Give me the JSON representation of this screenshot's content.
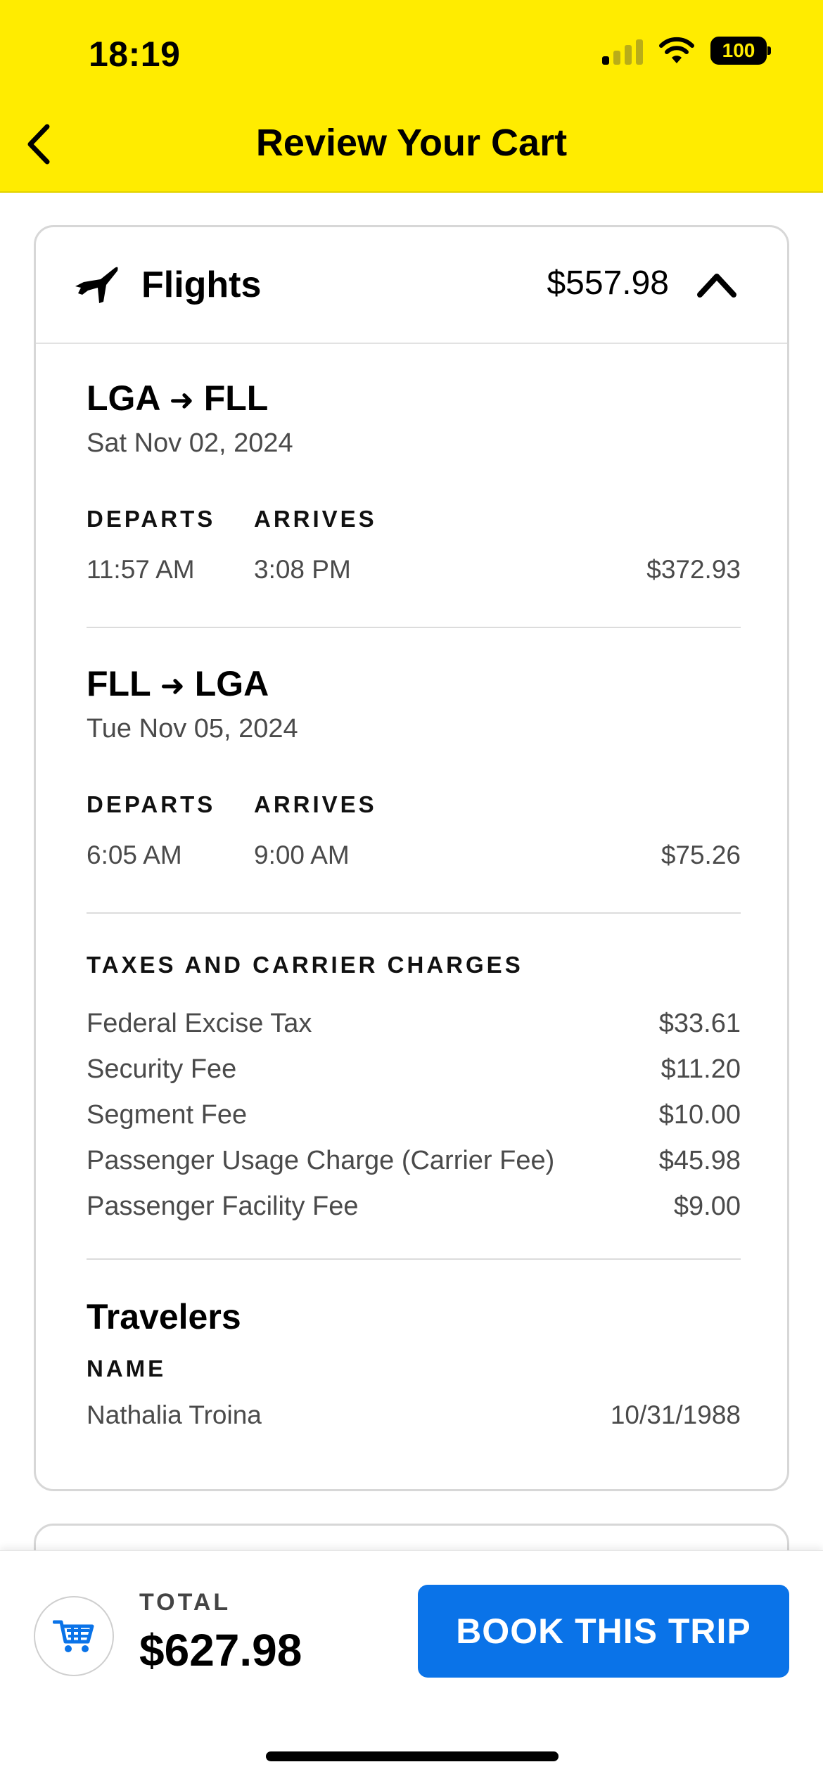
{
  "status_bar": {
    "time": "18:19",
    "battery": "100"
  },
  "header": {
    "title": "Review Your Cart"
  },
  "flights_card": {
    "title": "Flights",
    "price": "$557.98",
    "segments": [
      {
        "route_from": "LGA",
        "route_to": "FLL",
        "date": "Sat Nov 02, 2024",
        "departs_label": "DEPARTS",
        "arrives_label": "ARRIVES",
        "departs": "11:57 AM",
        "arrives": "3:08 PM",
        "price": "$372.93"
      },
      {
        "route_from": "FLL",
        "route_to": "LGA",
        "date": "Tue Nov 05, 2024",
        "departs_label": "DEPARTS",
        "arrives_label": "ARRIVES",
        "departs": "6:05 AM",
        "arrives": "9:00 AM",
        "price": "$75.26"
      }
    ],
    "taxes": {
      "heading": "TAXES AND CARRIER CHARGES",
      "items": [
        {
          "label": "Federal Excise Tax",
          "amount": "$33.61"
        },
        {
          "label": "Security Fee",
          "amount": "$11.20"
        },
        {
          "label": "Segment Fee",
          "amount": "$10.00"
        },
        {
          "label": "Passenger Usage Charge (Carrier Fee)",
          "amount": "$45.98"
        },
        {
          "label": "Passenger Facility Fee",
          "amount": "$9.00"
        }
      ]
    },
    "travelers": {
      "title": "Travelers",
      "name_label": "NAME",
      "name": "Nathalia Troina",
      "dob": "10/31/1988"
    }
  },
  "bottom_bar": {
    "total_label": "TOTAL",
    "total": "$627.98",
    "book_label": "BOOK THIS TRIP"
  },
  "colors": {
    "header_bg": "#ffec00",
    "button_bg": "#0a73e8"
  }
}
